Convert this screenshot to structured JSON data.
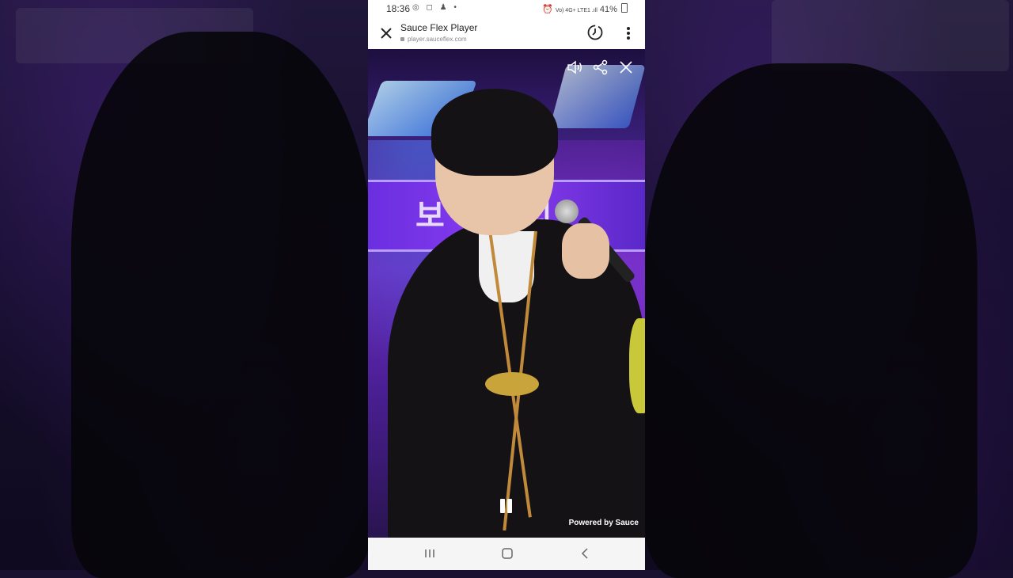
{
  "status_bar": {
    "time": "18:36",
    "left_icons": [
      "whatsapp-icon",
      "instagram-icon",
      "snapchat-icon",
      "dot-icon"
    ],
    "right_icons_text": "Vo) 4G+ LTE1 .ıll",
    "battery": "41%"
  },
  "browser": {
    "title": "Sauce Flex Player",
    "url": "player.sauceflex.com"
  },
  "video": {
    "powered_by": "Powered by Sauce",
    "stage_text": "보 인 리"
  },
  "colors": {
    "accent": "#7a36e6",
    "trim": "#c18a3a"
  }
}
